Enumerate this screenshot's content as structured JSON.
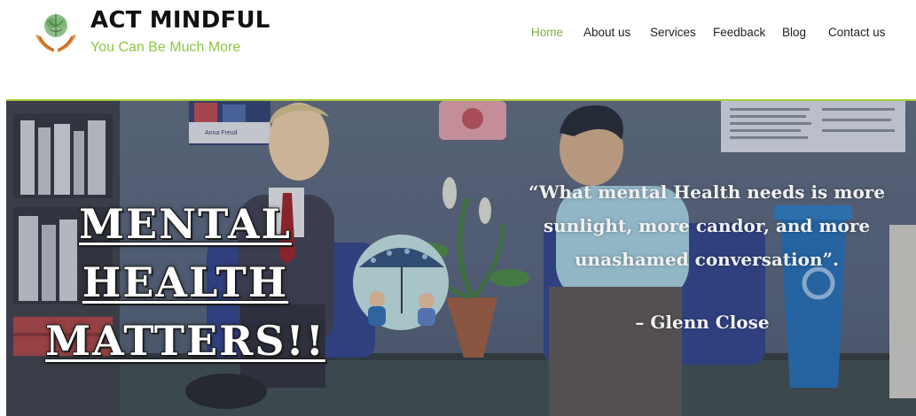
{
  "brand": {
    "name": "ACT MINDFUL",
    "tagline": "You Can Be Much More"
  },
  "nav": {
    "items": [
      {
        "label": "Home",
        "active": true
      },
      {
        "label": "About us",
        "active": false
      },
      {
        "label": "Services",
        "active": false
      },
      {
        "label": "Feedback",
        "active": false
      },
      {
        "label": "Blog",
        "active": false
      },
      {
        "label": "Contact us",
        "active": false
      }
    ]
  },
  "hero": {
    "title_lines": [
      "MENTAL",
      "HEALTH",
      "MATTERS!!"
    ],
    "quote": "“What mental Health needs is more sunlight, more candor, and more unashamed conversation”.",
    "author": "– Glenn Close",
    "poster_text": "Anna Freud"
  },
  "colors": {
    "accent": "#8cc63f",
    "nav_active": "#7cb342",
    "hero_border": "#a9cf3f",
    "text_dark": "#111111"
  }
}
